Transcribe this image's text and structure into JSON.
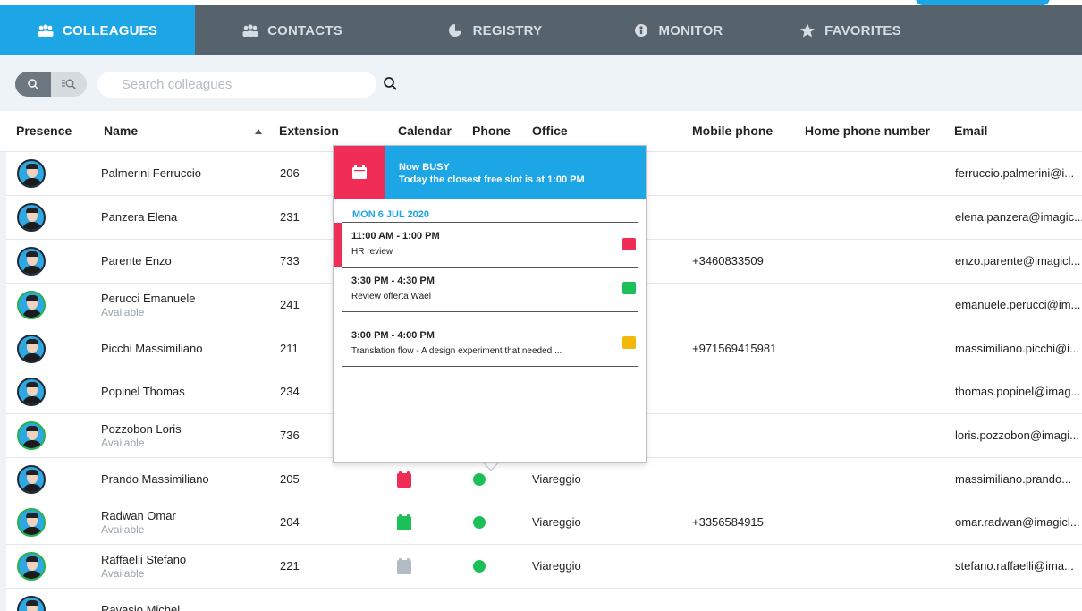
{
  "tabs": [
    {
      "label": "COLLEAGUES",
      "active": true,
      "icon": "people-icon"
    },
    {
      "label": "CONTACTS",
      "active": false,
      "icon": "contacts-icon"
    },
    {
      "label": "REGISTRY",
      "active": false,
      "icon": "pie-chart-icon"
    },
    {
      "label": "MONITOR",
      "active": false,
      "icon": "monitor-icon"
    },
    {
      "label": "FAVORITES",
      "active": false,
      "icon": "star-icon"
    }
  ],
  "search": {
    "placeholder": "Search colleagues"
  },
  "columns": {
    "presence": "Presence",
    "name": "Name",
    "extension": "Extension",
    "calendar": "Calendar",
    "phone": "Phone",
    "office": "Office",
    "mobile": "Mobile phone",
    "home": "Home phone number",
    "email": "Email"
  },
  "rows": [
    {
      "name": "Palmerini Ferruccio",
      "status": "",
      "ext": "206",
      "office": "",
      "mobile": "",
      "email": "ferruccio.palmerini@i...",
      "avatar_ring": "dark"
    },
    {
      "name": "Panzera Elena",
      "status": "",
      "ext": "231",
      "office": "",
      "mobile": "",
      "email": "elena.panzera@imagic...",
      "avatar_ring": "dark"
    },
    {
      "name": "Parente Enzo",
      "status": "",
      "ext": "733",
      "office": "",
      "mobile": "+3460833509",
      "email": "enzo.parente@imagicl...",
      "avatar_ring": "dark"
    },
    {
      "name": "Perucci Emanuele",
      "status": "Available",
      "ext": "241",
      "office": "",
      "mobile": "",
      "email": "emanuele.perucci@im...",
      "avatar_ring": "green"
    },
    {
      "name": "Picchi Massimiliano",
      "status": "",
      "ext": "211",
      "office": "",
      "mobile": "+971569415981",
      "email": "massimiliano.picchi@i...",
      "avatar_ring": "dark"
    },
    {
      "name": "Popinel Thomas",
      "status": "",
      "ext": "234",
      "office": "",
      "mobile": "",
      "email": "thomas.popinel@imag...",
      "avatar_ring": "dark"
    },
    {
      "name": "Pozzobon Loris",
      "status": "Available",
      "ext": "736",
      "office": "",
      "mobile": "",
      "email": "loris.pozzobon@imagi...",
      "avatar_ring": "green"
    },
    {
      "name": "Prando Massimiliano",
      "status": "",
      "ext": "205",
      "office": "Viareggio",
      "mobile": "",
      "email": "massimiliano.prando...",
      "avatar_ring": "dark",
      "calendar": "#ef2d56",
      "phone": "#1dbf58"
    },
    {
      "name": "Radwan Omar",
      "status": "Available",
      "ext": "204",
      "office": "Viareggio",
      "mobile": "+3356584915",
      "email": "omar.radwan@imagicl...",
      "avatar_ring": "green",
      "calendar": "#1dbf58",
      "phone": "#1dbf58"
    },
    {
      "name": "Raffaelli Stefano",
      "status": "Available",
      "ext": "221",
      "office": "Viareggio",
      "mobile": "",
      "email": "stefano.raffaelli@ima...",
      "avatar_ring": "green",
      "calendar": "#b3bcc4",
      "phone": "#1dbf58"
    },
    {
      "name": "Ravasio Michel",
      "status": "",
      "ext": "",
      "office": "",
      "mobile": "",
      "email": "",
      "avatar_ring": "dark"
    }
  ],
  "popover": {
    "status_title": "Now BUSY",
    "status_detail": "Today the closest free slot is at 1:00 PM",
    "date": "MON 6 JUL 2020",
    "events": [
      {
        "time": "11:00 AM - 1:00 PM",
        "title": "HR review",
        "color": "#ef2d56",
        "current": true
      },
      {
        "time": "3:30 PM - 4:30 PM",
        "title": "Review offerta Wael",
        "color": "#1dbf58",
        "current": false
      },
      {
        "time": "3:00 PM - 4:00 PM",
        "title": "Translation flow - A design experiment that needed ...",
        "color": "#f2b90c",
        "current": false
      }
    ]
  }
}
